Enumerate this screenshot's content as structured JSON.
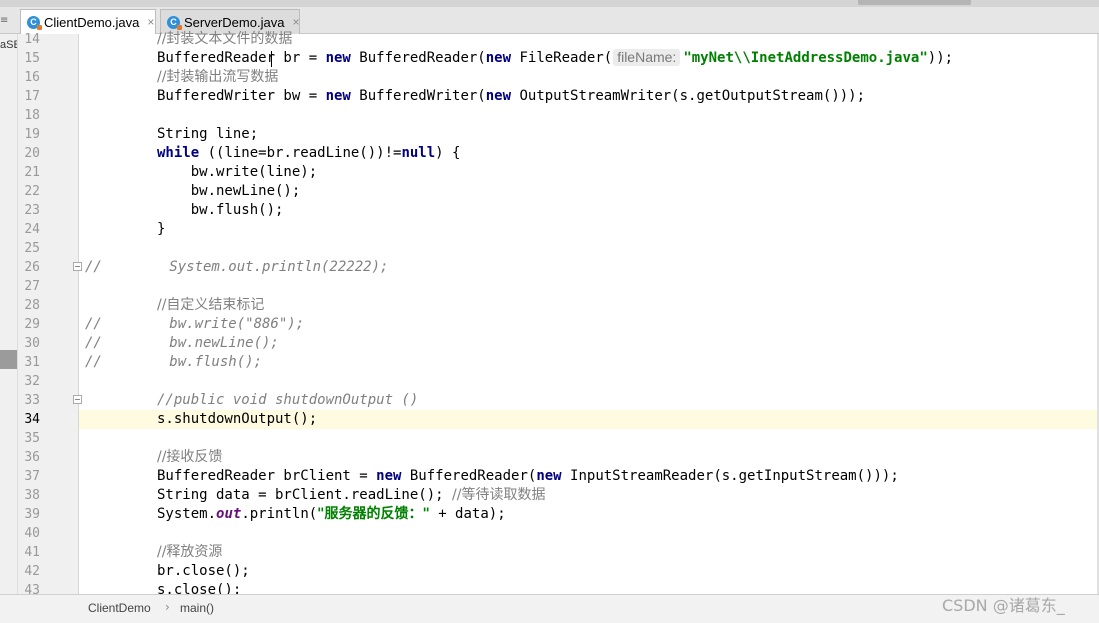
{
  "tabs": [
    {
      "label": "ClientDemo.java",
      "icon": "java-class-icon",
      "glyph": "C",
      "close": "×",
      "active": true
    },
    {
      "label": "ServerDemo.java",
      "icon": "java-class-icon",
      "glyph": "C",
      "close": "×",
      "active": false
    }
  ],
  "tool_strip": {
    "label": "aSE",
    "glyph": "≡"
  },
  "lines": [
    {
      "n": "14",
      "parts": [
        [
          "cmt",
          "//封装文本文件的数据"
        ]
      ]
    },
    {
      "n": "15",
      "parts": [
        [
          "",
          "BufferedReader br = "
        ],
        [
          "kw",
          "new"
        ],
        [
          "",
          " BufferedReader("
        ],
        [
          "kw",
          "new"
        ],
        [
          "",
          " FileReader("
        ],
        [
          "hint",
          "fileName:"
        ],
        [
          "str",
          "\"myNet\\\\InetAddressDemo.java\""
        ],
        [
          "",
          "));"
        ]
      ]
    },
    {
      "n": "16",
      "parts": [
        [
          "cmt",
          "//封装输出流写数据"
        ]
      ]
    },
    {
      "n": "17",
      "parts": [
        [
          "",
          "BufferedWriter bw = "
        ],
        [
          "kw",
          "new"
        ],
        [
          "",
          " BufferedWriter("
        ],
        [
          "kw",
          "new"
        ],
        [
          "",
          " OutputStreamWriter(s.getOutputStream()));"
        ]
      ]
    },
    {
      "n": "18",
      "parts": []
    },
    {
      "n": "19",
      "parts": [
        [
          "",
          "String line;"
        ]
      ]
    },
    {
      "n": "20",
      "parts": [
        [
          "kw",
          "while"
        ],
        [
          "",
          " ((line=br.readLine())!="
        ],
        [
          "kw",
          "null"
        ],
        [
          "",
          ") {"
        ]
      ]
    },
    {
      "n": "21",
      "parts": [
        [
          "",
          "    bw.write(line);"
        ]
      ]
    },
    {
      "n": "22",
      "parts": [
        [
          "",
          "    bw.newLine();"
        ]
      ]
    },
    {
      "n": "23",
      "parts": [
        [
          "",
          "    bw.flush();"
        ]
      ]
    },
    {
      "n": "24",
      "parts": [
        [
          "",
          "}"
        ]
      ]
    },
    {
      "n": "25",
      "parts": []
    },
    {
      "n": "26",
      "fold": true,
      "commented": true,
      "parts": [
        [
          "cmt",
          "//        System.out.println(22222);"
        ]
      ]
    },
    {
      "n": "27",
      "parts": []
    },
    {
      "n": "28",
      "parts": [
        [
          "cmt",
          "//自定义结束标记"
        ]
      ]
    },
    {
      "n": "29",
      "commented": true,
      "parts": [
        [
          "cmt",
          "//        bw.write(\"886\");"
        ]
      ]
    },
    {
      "n": "30",
      "commented": true,
      "parts": [
        [
          "cmt",
          "//        bw.newLine();"
        ]
      ]
    },
    {
      "n": "31",
      "commented": true,
      "parts": [
        [
          "cmt",
          "//        bw.flush();"
        ]
      ]
    },
    {
      "n": "32",
      "parts": []
    },
    {
      "n": "33",
      "fold": true,
      "parts": [
        [
          "cmt",
          "//public void shutdownOutput ()"
        ]
      ]
    },
    {
      "n": "34",
      "current": true,
      "parts": [
        [
          "",
          "s.shutdownOutput();"
        ]
      ]
    },
    {
      "n": "35",
      "parts": []
    },
    {
      "n": "36",
      "parts": [
        [
          "cmt",
          "//接收反馈"
        ]
      ]
    },
    {
      "n": "37",
      "parts": [
        [
          "",
          "BufferedReader brClient = "
        ],
        [
          "kw",
          "new"
        ],
        [
          "",
          " BufferedReader("
        ],
        [
          "kw",
          "new"
        ],
        [
          "",
          " InputStreamReader(s.getInputStream()));"
        ]
      ]
    },
    {
      "n": "38",
      "parts": [
        [
          "",
          "String data = brClient.readLine(); "
        ],
        [
          "cmt",
          "//等待读取数据"
        ]
      ]
    },
    {
      "n": "39",
      "parts": [
        [
          "",
          "System."
        ],
        [
          "fld",
          "out"
        ],
        [
          "",
          ".println("
        ],
        [
          "str",
          "\"服务器的反馈：\""
        ],
        [
          "",
          " + data);"
        ]
      ]
    },
    {
      "n": "40",
      "parts": []
    },
    {
      "n": "41",
      "parts": [
        [
          "cmt",
          "//释放资源"
        ]
      ]
    },
    {
      "n": "42",
      "parts": [
        [
          "",
          "br.close();"
        ]
      ]
    },
    {
      "n": "43",
      "parts": [
        [
          "",
          "s.close();"
        ]
      ]
    }
  ],
  "breadcrumb": {
    "items": [
      "ClientDemo",
      "main()"
    ],
    "separator": "›"
  },
  "watermark": "CSDN @诸葛东_",
  "colors": {
    "keyword": "#000080",
    "string": "#008000",
    "comment": "#808080",
    "field": "#660e7a",
    "current_line": "#fffbe0"
  }
}
